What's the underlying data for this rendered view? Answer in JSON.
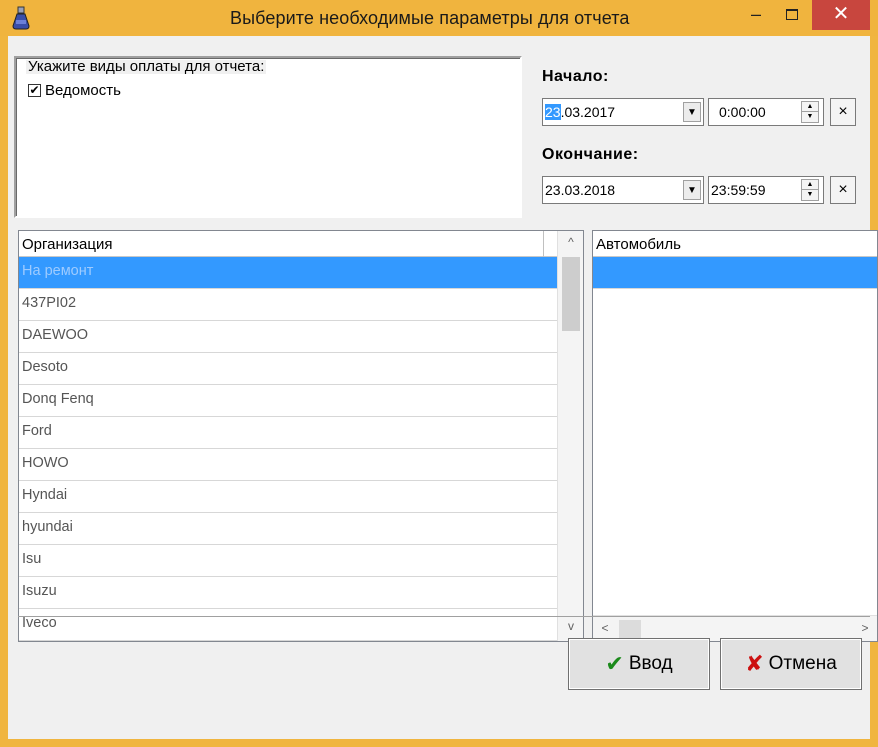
{
  "window": {
    "title": "Выберите необходимые параметры для отчета",
    "minimize": "–",
    "close": "✕"
  },
  "payment": {
    "label": "Укажите виды оплаты для отчета:",
    "items": [
      {
        "label": "Ведомость",
        "checked": true,
        "check_glyph": "✔"
      }
    ]
  },
  "start": {
    "label": "Начало:",
    "date_selected": "23",
    "date_rest": ".03.2017",
    "time": "0:00:00"
  },
  "end": {
    "label": "Окончание:",
    "date": "23.03.2018",
    "time": "23:59:59"
  },
  "organizations": {
    "header": "Организация",
    "rows": [
      "На ремонт",
      "437PI02",
      "DAEWOO",
      "Desoto",
      "Donq Fenq",
      "Ford",
      "HOWO",
      "Hyndai",
      "hyundai",
      "Isu",
      "Isuzu",
      "Iveco"
    ],
    "selected_index": 0
  },
  "cars": {
    "header": "Автомобиль"
  },
  "buttons": {
    "ok_label": "Ввод",
    "cancel_label": "Отмена"
  },
  "icons": {
    "clear_glyph": "×",
    "dropdown_glyph": "▼",
    "up_glyph": "▲",
    "down_glyph": "▼",
    "scroll_up": "^",
    "scroll_down": "v",
    "scroll_left": "<",
    "scroll_right": ">",
    "ok_glyph": "✔",
    "cancel_glyph": "✘"
  }
}
